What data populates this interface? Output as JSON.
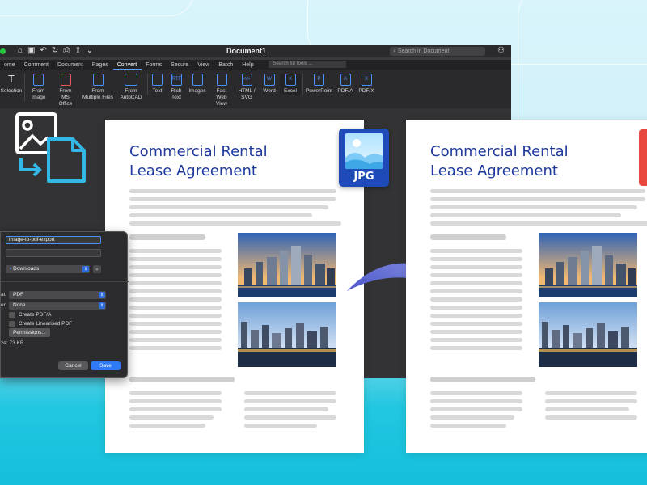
{
  "window": {
    "title": "Document1",
    "search_placeholder": "Search in Document"
  },
  "menu": {
    "items": [
      "ome",
      "Comment",
      "Document",
      "Pages",
      "Convert",
      "Forms",
      "Secure",
      "View",
      "Batch",
      "Help"
    ],
    "active": "Convert",
    "tool_search_placeholder": "Search for tools ..."
  },
  "ribbon": {
    "buttons": [
      {
        "label": "Selection",
        "icon": "text-cursor-icon"
      },
      {
        "label": "From Image",
        "icon": "image-file-icon"
      },
      {
        "label": "From MS Office",
        "icon": "ms-office-icon"
      },
      {
        "label": "From Multiple Files",
        "icon": "multiple-files-icon"
      },
      {
        "label": "From AutoCAD",
        "icon": "autocad-icon"
      },
      {
        "label": "Text",
        "icon": "text-file-icon"
      },
      {
        "label": "Rich Text",
        "icon": "rtf-icon"
      },
      {
        "label": "Images",
        "icon": "image-icon"
      },
      {
        "label": "Fast Web View",
        "icon": "web-view-icon"
      },
      {
        "label": "HTML / SVG",
        "icon": "html-icon"
      },
      {
        "label": "Word",
        "icon": "word-icon"
      },
      {
        "label": "Excel",
        "icon": "excel-icon"
      },
      {
        "label": "PowerPoint",
        "icon": "powerpoint-icon"
      },
      {
        "label": "PDF/A",
        "icon": "pdfa-icon"
      },
      {
        "label": "PDF/X",
        "icon": "pdfx-icon"
      }
    ]
  },
  "dialog": {
    "filename": "image-to-pdf-export",
    "location": "Downloads",
    "format_label": "at:",
    "format_value": "PDF",
    "filter_label": "er:",
    "filter_value": "None",
    "checkbox_pdfa": "Create PDF/A",
    "checkbox_linearised": "Create Linearised PDF",
    "permissions_button": "Permissions...",
    "size_text": "ze: 73 KB",
    "cancel": "Cancel",
    "save": "Save"
  },
  "document": {
    "title_line1": "Commercial Rental",
    "title_line2": "Lease Agreement"
  },
  "badge": {
    "text": "JPG"
  },
  "colors": {
    "accent": "#1f3a9c",
    "save_button": "#2f7bf5",
    "badge": "#1e4bb8",
    "cyan": "#14c0dc"
  }
}
